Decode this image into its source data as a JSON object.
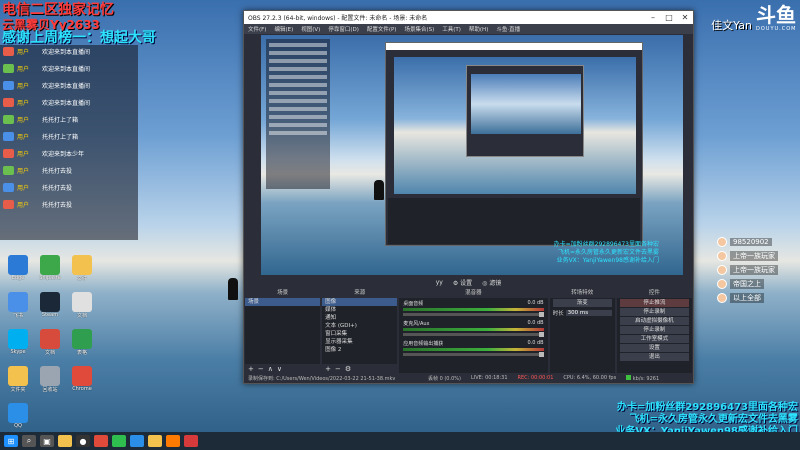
{
  "overlay": {
    "title_red": "电信二区独家记忆",
    "title_red2": "云黑雾贝Yy2633",
    "title_cyan": "感谢上周榜一：想起大哥",
    "promo_lines": [
      "办卡=加粉丝群292896473里面各种宏",
      "飞机=永久房管永久更新宏文件去黑雾",
      "业务VX：YanjiYawen98感谢补给入门"
    ],
    "author": "佳文Yan",
    "douyu_logo": "斗鱼",
    "douyu_sub": "DOUYU.COM"
  },
  "chat": {
    "rows": [
      {
        "name": "用户",
        "text": "欢迎来到本直播间"
      },
      {
        "name": "用户",
        "text": "欢迎来到本直播间"
      },
      {
        "name": "用户",
        "text": "欢迎来到本直播间"
      },
      {
        "name": "用户",
        "text": "欢迎来到本直播间"
      },
      {
        "name": "用户",
        "text": "托托打上了箱"
      },
      {
        "name": "用户",
        "text": "托托打上了箱"
      },
      {
        "name": "用户",
        "text": "欢迎来到本少年"
      },
      {
        "name": "用户",
        "text": "托托打去投"
      },
      {
        "name": "用户",
        "text": "托托打去投"
      },
      {
        "name": "用户",
        "text": "托托打去投"
      }
    ]
  },
  "rank": {
    "rows": [
      {
        "text": "98520902"
      },
      {
        "text": "上帝一族玩家"
      },
      {
        "text": "上帝一族玩家"
      },
      {
        "text": "帝国之上"
      },
      {
        "text": "以上全部"
      }
    ]
  },
  "desktop_icons": [
    {
      "label": "Edge"
    },
    {
      "label": "Snipaste"
    },
    {
      "label": "文件"
    },
    {
      "label": "飞书"
    },
    {
      "label": "Steam"
    },
    {
      "label": "文档"
    },
    {
      "label": "Skype"
    },
    {
      "label": "文档"
    },
    {
      "label": "表格"
    },
    {
      "label": "文件夹"
    },
    {
      "label": "回收站"
    },
    {
      "label": "Chrome"
    },
    {
      "label": "QQ"
    }
  ],
  "obs": {
    "title": "OBS 27.2.3 (64-bit, windows) - 配置文件: 未命名 - 场景: 未命名",
    "menu": [
      "文件(F)",
      "编辑(E)",
      "视图(V)",
      "停靠窗口(D)",
      "配置文件(P)",
      "场景集合(S)",
      "工具(T)",
      "帮助(H)",
      "斗鱼·直播"
    ],
    "scene_bar": {
      "scene": "yy",
      "settings": "设置",
      "filters": "滤镜"
    },
    "docks": {
      "scenes_header": "场景",
      "scenes": [
        "场景"
      ],
      "sources_header": "来源",
      "sources": [
        "图像",
        "媒体",
        "通知",
        "文本 (GDI+)",
        "窗口采集",
        "显示器采集",
        "图像 2"
      ],
      "mixer_header": "混音器",
      "mixer": [
        {
          "name": "桌面音频",
          "db": "0.0 dB"
        },
        {
          "name": "麦克风/Aux",
          "db": "0.0 dB"
        },
        {
          "name": "应用音频输出捕获",
          "db": "0.0 dB"
        }
      ],
      "transitions_header": "转场特效",
      "transition_type": "渐变",
      "duration_label": "时长",
      "duration_value": "300 ms",
      "controls_header": "控件",
      "controls": [
        "停止推流",
        "停止录制",
        "启动虚拟摄像机",
        "停止录制",
        "工作室模式",
        "设置",
        "退出"
      ]
    },
    "status": {
      "path": "录制保存到: C:/Users/Wen/Videos/2022-03-22 21-51-38.mkv",
      "dropped": "丢帧 0 (0.0%)",
      "live": "LIVE: 00:18:31",
      "rec": "REC: 00:00:01",
      "cpu": "CPU: 6.4%, 60.00 fps",
      "kbps": "kb/s: 9261"
    }
  },
  "preview_promo": [
    "办卡=加粉丝群292896473里面各种宏",
    "飞机=永久房管永久更新宏文件去黑雾",
    "业务VX：YanjiYawen98感谢补给入门"
  ],
  "taskbar": {
    "icons": [
      "start",
      "search",
      "taskview",
      "explorer",
      "obs",
      "chrome",
      "wechat",
      "qq",
      "folder",
      "douyu",
      "wps"
    ]
  },
  "colors": {
    "obs_bg": "#2b2e38",
    "overlay_red": "#ff3b3b",
    "overlay_cyan": "#2de4ff",
    "taskbar": "#1d2a38"
  }
}
